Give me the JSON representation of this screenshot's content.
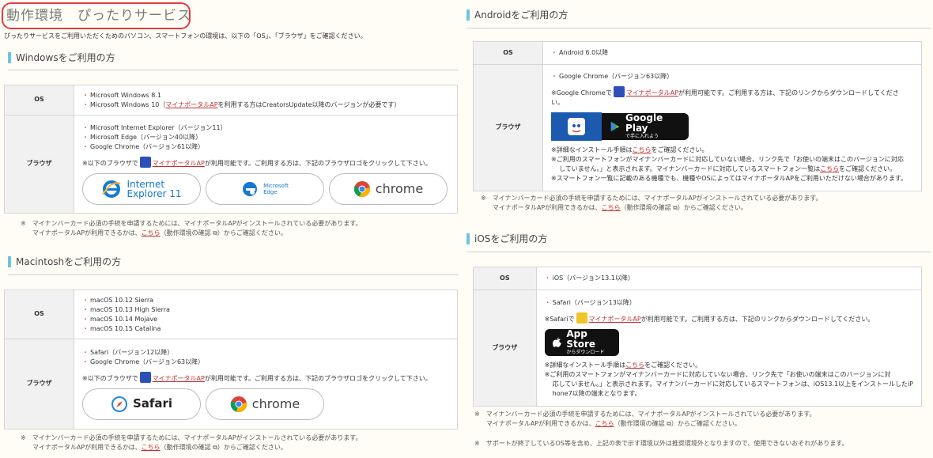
{
  "page_title": "動作環境　ぴったりサービス",
  "intro": "ぴったりサービスをご利用いただくためのパソコン、スマートフォンの環境は、以下の「OS」、「ブラウザ」をご確認ください。",
  "common": {
    "os_label": "OS",
    "browser_label": "ブラウザ",
    "mp_link": "マイナポータルAP",
    "here_link": "こちら",
    "check_link": "動作環境の確認",
    "kome": "※"
  },
  "windows": {
    "heading": "Windowsをご利用の方",
    "os_items": [
      "Microsoft Windows 8.1",
      "Microsoft Windows 10（"
    ],
    "os_item2_suffix": "を利用する方はCreatorsUpdate以降のバージョンが必要です）",
    "browser_items": [
      "Microsoft Internet Explorer（バージョン11）",
      "Microsoft Edge（バージョン40以降）",
      "Google Chrome（バージョン61以降）"
    ],
    "note_prefix": "※以下のブラウザで",
    "note_suffix": "が利用可能です。ご利用する方は、下記のブラウザロゴをクリックして下さい。",
    "logos": {
      "ie_line1": "Internet",
      "ie_line2": "Explorer 11",
      "edge_line1": "Microsoft",
      "edge_line2": "Edge",
      "chrome": "chrome"
    },
    "foot1": "マイナンバーカード必須の手続を申請するためには、マイナポータルAPがインストールされている必要があります。",
    "foot2_prefix": "マイナポータルAPが利用できるかは、",
    "foot2_mid": "（動作環境の確認",
    "foot2_suffix": "）からご確認ください。"
  },
  "mac": {
    "heading": "Macintoshをご利用の方",
    "os_items": [
      "macOS 10.12 Sierra",
      "macOS 10.13 High Sierra",
      "macOS 10.14 Mojave",
      "macOS 10.15 Catalina"
    ],
    "browser_items": [
      "Safari（バージョン12以降）",
      "Google Chrome（バージョン63以降）"
    ],
    "note_prefix": "※以下のブラウザで",
    "note_suffix": "が利用可能です。ご利用する方は、下記のブラウザロゴをクリックして下さい。",
    "logos": {
      "safari": "Safari",
      "chrome": "chrome"
    },
    "foot1": "マイナンバーカード必須の手続を申請するためには、マイナポータルAPがインストールされている必要があります。",
    "foot2_prefix": "マイナポータルAPが利用できるかは、",
    "foot2_mid": "（動作環境の確認",
    "foot2_suffix": "）からご確認ください。"
  },
  "android": {
    "heading": "Androidをご利用の方",
    "os_items": [
      "Android 6.0以降"
    ],
    "browser_items": [
      "Google Chrome（バージョン63以降）"
    ],
    "note_prefix": "※Google Chromeで",
    "note_suffix": "が利用可能です。ご利用する方は、下記のリンクからダウンロードしてくださ",
    "note_suffix2": "い。",
    "gp_line1": "Google Play",
    "gp_line2": "で手に入れよう",
    "details_prefix": "※詳細なインストール手順は",
    "details_suffix": "をご確認ください。",
    "note3_line1": "※ご利用のスマートフォンがマイナンバーカードに対応していない場合、リンク先で「お使いの端末はこのバージョンに対応",
    "note3_line2_prefix": "していません。」と表示されます。マイナンバーカードに対応しているスマートフォン一覧は",
    "note3_line2_suffix": "をご確認ください。",
    "note4": "※スマートフォン一覧に記載のある機種でも、機種やOSによってはマイナポータルAPをご利用いただけない場合があります。",
    "foot1": "マイナンバーカード必須の手続を申請するためには、マイナポータルAPがインストールされている必要があります。",
    "foot2_prefix": "マイナポータルAPが利用できるかは、",
    "foot2_mid": "（動作環境の確認",
    "foot2_suffix": "）からご確認ください。"
  },
  "ios": {
    "heading": "iOSをご利用の方",
    "os_items": [
      "iOS（バージョン13.1以降）"
    ],
    "browser_items": [
      "Safari（バージョン13以降）"
    ],
    "note_prefix": "※Safariで",
    "note_suffix": "が利用可能です。ご利用する方は、下記のリンクからダウンロードしてください。",
    "as_line1": "App Store",
    "as_line2": "からダウンロード",
    "details_prefix": "※詳細なインストール手順は",
    "details_suffix": "をご確認ください。",
    "note3_line1": "※ご利用のスマートフォンがマイナンバーカードに対応していない場合、リンク先で「お使いの端末はこのバージョンに対",
    "note3_line2": "応していません。」と表示されます。マイナンバーカードに対応しているスマートフォンは、iOS13.1以上をインストールしたiP",
    "note3_line3": "hone7以降の端末となります。",
    "foot1": "マイナンバーカード必須の手続を申請するためには、マイナポータルAPがインストールされている必要があります。",
    "foot2_prefix": "マイナポータルAPが利用できるかは、",
    "foot2_mid": "（動作環境の確認",
    "foot2_suffix": "）からご確認ください。",
    "foot3": "サポートが終了しているOS等を含め、上記の表で示す環境以外は推奨環境外となりますので、使用できないおそれがあります。"
  }
}
